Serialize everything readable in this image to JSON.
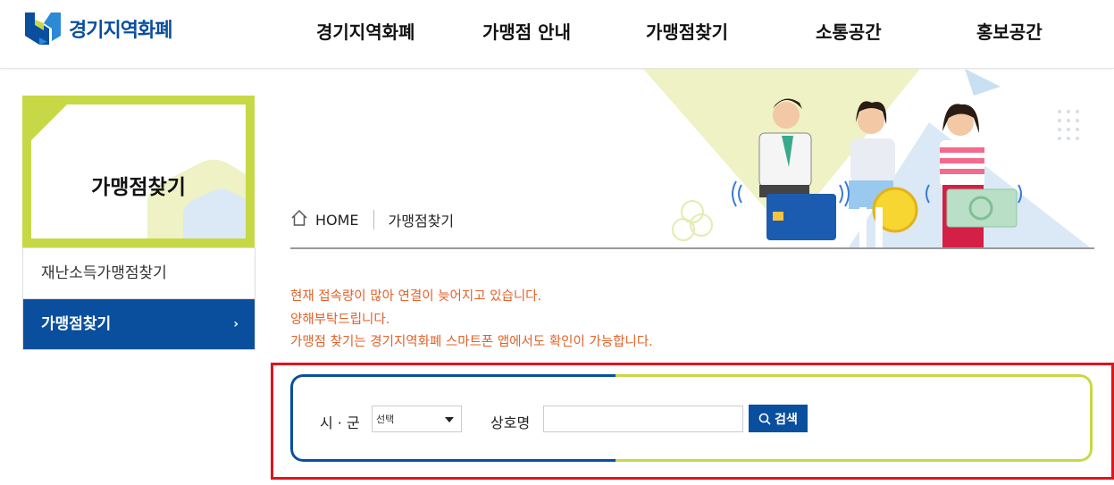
{
  "header": {
    "logo_text": "경기지역화폐",
    "nav": [
      "경기지역화폐",
      "가맹점 안내",
      "가맹점찾기",
      "소통공간",
      "홍보공간"
    ]
  },
  "sidebar": {
    "title": "가맹점찾기",
    "items": [
      {
        "label": "재난소득가맹점찾기",
        "active": false
      },
      {
        "label": "가맹점찾기",
        "active": true,
        "chevron": "›"
      }
    ]
  },
  "breadcrumb": {
    "home": "HOME",
    "current": "가맹점찾기"
  },
  "notice": [
    "현재 접속량이 많아 연결이 늦어지고 있습니다.",
    "양해부탁드립니다.",
    "가맹점 찾기는 경기지역화폐 스마트폰 앱에서도 확인이 가능합니다."
  ],
  "search": {
    "region_label": "시 · 군",
    "region_selected": "선택",
    "name_label": "상호명",
    "name_value": "",
    "button_label": "검색"
  },
  "colors": {
    "primary": "#0a4f9e",
    "lime": "#c7d846",
    "notice": "#e2622a",
    "highlight": "#e0141e"
  }
}
